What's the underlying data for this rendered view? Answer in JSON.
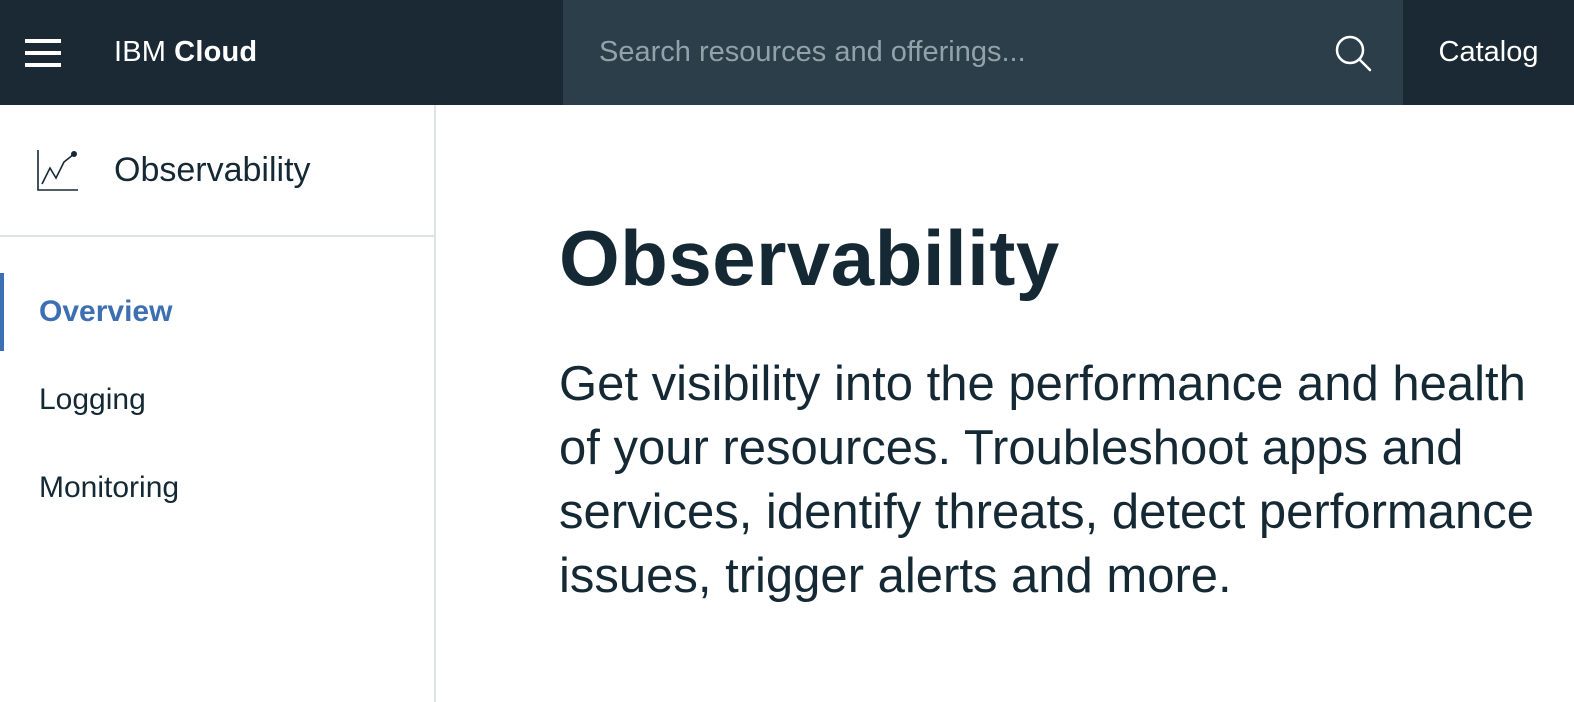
{
  "header": {
    "brand_prefix": "IBM",
    "brand_strong": "Cloud",
    "search_placeholder": "Search resources and offerings...",
    "catalog_label": "Catalog",
    "background_color": "#1a2934",
    "search_background_color": "#2c3e49"
  },
  "sidebar": {
    "title": "Observability",
    "icon": "chart-line-icon",
    "items": [
      {
        "label": "Overview",
        "active": true
      },
      {
        "label": "Logging",
        "active": false
      },
      {
        "label": "Monitoring",
        "active": false
      }
    ],
    "accent_color": "#3d70b2"
  },
  "main": {
    "title": "Observability",
    "description": "Get visibility into the performance and health of your resources. Troubleshoot apps and services, identify threats, detect performance issues, trigger alerts and more."
  }
}
